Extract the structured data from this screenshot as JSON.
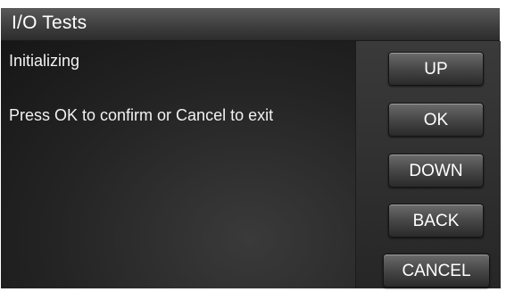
{
  "window": {
    "title": "I/O Tests"
  },
  "content": {
    "status": "Initializing",
    "instruction": "Press OK to confirm or Cancel to exit"
  },
  "buttons": {
    "up": "UP",
    "ok": "OK",
    "down": "DOWN",
    "back": "BACK",
    "cancel": "CANCEL"
  },
  "colors": {
    "panel": "#242424",
    "title_bar": "#3f3f3f",
    "text": "#ffffff"
  }
}
